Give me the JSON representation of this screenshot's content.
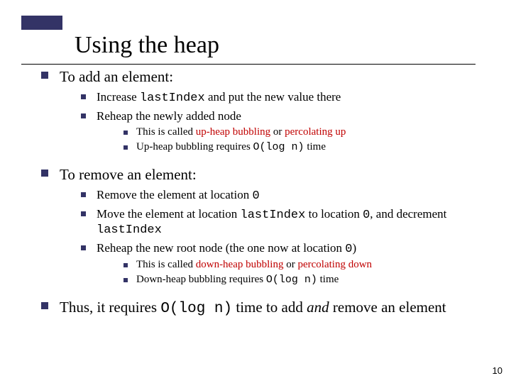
{
  "title": "Using the heap",
  "sec1": {
    "heading": "To add an element:",
    "p1_a": "Increase ",
    "p1_code": "lastIndex",
    "p1_b": " and put the new value there",
    "p2": "Reheap the newly added node",
    "s1_a": "This is called ",
    "s1_r1": "up-heap bubbling",
    "s1_b": " or ",
    "s1_r2": "percolating up",
    "s2_a": "Up-heap bubbling requires ",
    "s2_code": "O(log n)",
    "s2_b": " time"
  },
  "sec2": {
    "heading": "To remove an element:",
    "p1_a": "Remove the element at location ",
    "p1_code": "0",
    "p2_a": "Move the element at location ",
    "p2_code1": "lastIndex",
    "p2_b": " to location ",
    "p2_code2": "0",
    "p2_c": ", and decrement ",
    "p2_code3": "lastIndex",
    "p3_a": "Reheap the new root node (the one now at location ",
    "p3_code": "0",
    "p3_b": ")",
    "s1_a": "This is called ",
    "s1_r1": "down-heap bubbling",
    "s1_b": " or ",
    "s1_r2": "percolating down",
    "s2_a": "Down-heap bubbling requires ",
    "s2_code": "O(log n)",
    "s2_b": " time"
  },
  "sec3": {
    "a": "Thus, it requires ",
    "code": "O(log n)",
    "b": " time to add ",
    "it": "and ",
    "c": "remove an element"
  },
  "page": "10"
}
